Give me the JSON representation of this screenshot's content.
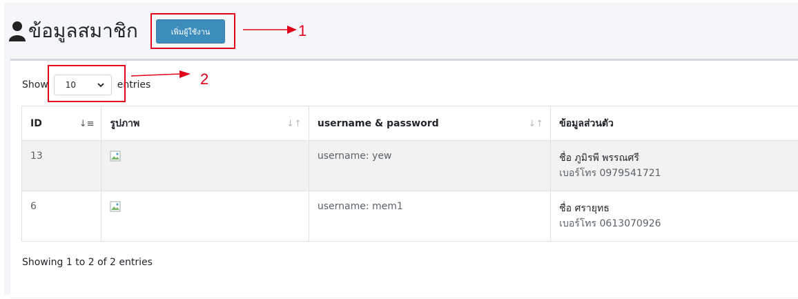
{
  "header": {
    "title": "ข้อมูลสมาชิก",
    "add_button_label": "เพิ่มผู้ใช้งาน"
  },
  "annotations": {
    "one": "1",
    "two": "2"
  },
  "length_control": {
    "show_label": "Show",
    "selected": "10",
    "entries_label": "entries"
  },
  "table": {
    "columns": [
      "ID",
      "รูปภาพ",
      "username & password",
      "ข้อมูลส่วนตัว"
    ],
    "rows": [
      {
        "id": "13",
        "username": "username: yew",
        "name": "ชื่อ ภูมิรพี พรรณศรี",
        "phone": "เบอร์โทร 0979541721"
      },
      {
        "id": "6",
        "username": "username: mem1",
        "name": "ชื่อ ศรายุทธ",
        "phone": "เบอร์โทร 0613070926"
      }
    ]
  },
  "info": "Showing 1 to 2 of 2 entries",
  "colors": {
    "primary_button": "#3c8dbc",
    "annotation_red": "#e3001b"
  }
}
